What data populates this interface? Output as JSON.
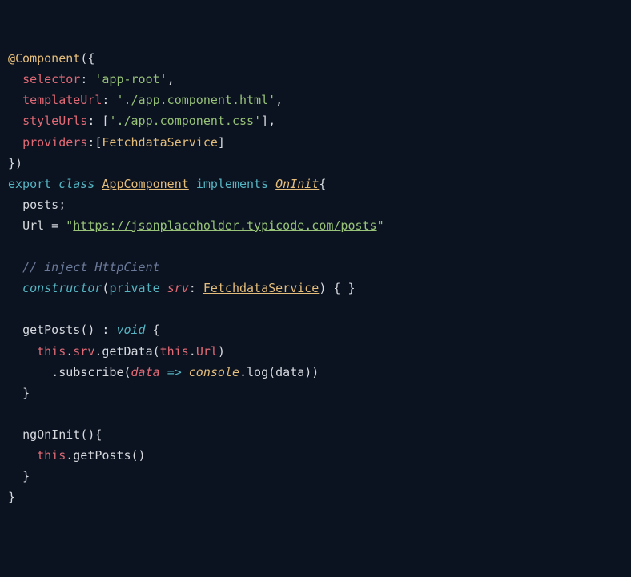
{
  "code": {
    "l1_at": "@",
    "l1_dec": "Component",
    "l1_open": "({",
    "l2_ind": "  ",
    "l2_key": "selector",
    "l2_colon": ": ",
    "l2_q1": "'",
    "l2_val": "app-root",
    "l2_q2": "'",
    "l2_comma": ",",
    "l3_ind": "  ",
    "l3_key": "templateUrl",
    "l3_colon": ": ",
    "l3_q1": "'",
    "l3_val": "./app.component.html",
    "l3_q2": "'",
    "l3_comma": ",",
    "l4_ind": "  ",
    "l4_key": "styleUrls",
    "l4_colon": ": [",
    "l4_q1": "'",
    "l4_val": "./app.component.css",
    "l4_q2": "'",
    "l4_close": "],",
    "l5_ind": "  ",
    "l5_key": "providers",
    "l5_colon": ":[",
    "l5_val": "FetchdataService",
    "l5_close": "]",
    "l6": "})",
    "l7_exp": "export",
    "l7_sp1": " ",
    "l7_cls": "class",
    "l7_sp2": " ",
    "l7_name": "AppComponent",
    "l7_sp3": " ",
    "l7_impl": "implements",
    "l7_sp4": " ",
    "l7_iface": "OnInit",
    "l7_brace": "{",
    "l8_ind": "  ",
    "l8_posts": "posts",
    "l8_semi": ";",
    "l9_ind": "  ",
    "l9_url": "Url",
    "l9_eq": " = ",
    "l9_q1": "\"",
    "l9_val": "https://jsonplaceholder.typicode.com/posts",
    "l9_q2": "\"",
    "l11_ind": "  ",
    "l11_cmt": "// inject HttpCient",
    "l12_ind": "  ",
    "l12_con": "constructor",
    "l12_op": "(",
    "l12_priv": "private",
    "l12_sp": " ",
    "l12_srv": "srv",
    "l12_colon": ": ",
    "l12_type": "FetchdataService",
    "l12_close": ") { }",
    "l14_ind": "  ",
    "l14_fn": "getPosts",
    "l14_paren": "() : ",
    "l14_void": "void",
    "l14_brace": " {",
    "l15_ind": "    ",
    "l15_this": "this",
    "l15_dot1": ".",
    "l15_srv": "srv",
    "l15_dot2": ".",
    "l15_get": "getData",
    "l15_op": "(",
    "l15_this2": "this",
    "l15_dot3": ".",
    "l15_url": "Url",
    "l15_close": ")",
    "l16_ind": "      .",
    "l16_sub": "subscribe",
    "l16_op": "(",
    "l16_data": "data",
    "l16_sp1": " ",
    "l16_arrow": "=>",
    "l16_sp2": " ",
    "l16_cons": "console",
    "l16_dot": ".",
    "l16_log": "log",
    "l16_op2": "(",
    "l16_data2": "data",
    "l16_close": "))",
    "l17_ind": "  ",
    "l17_brace": "}",
    "l19_ind": "  ",
    "l19_fn": "ngOnInit",
    "l19_paren": "(){",
    "l20_ind": "    ",
    "l20_this": "this",
    "l20_dot": ".",
    "l20_call": "getPosts",
    "l20_paren": "()",
    "l21_ind": "  ",
    "l21_brace": "}",
    "l22_brace": "}"
  }
}
